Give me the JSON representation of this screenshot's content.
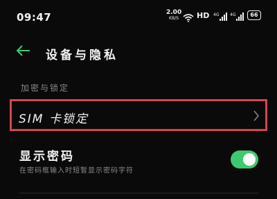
{
  "status_bar": {
    "time": "09:47",
    "net_speed_value": "2.00",
    "net_speed_unit": "KB/S",
    "hd_label": "HD",
    "signal_1_label": "4G",
    "signal_2_label": "4G",
    "battery_level": "66"
  },
  "header": {
    "title": "设备与隐私"
  },
  "section": {
    "label": "加密与锁定"
  },
  "sim_lock": {
    "label": "SIM 卡锁定",
    "highlight_color": "#d8434f"
  },
  "show_password": {
    "title": "显示密码",
    "description": "在密码框输入时短暂显示密码字符",
    "enabled": true,
    "toggle_color": "#3ec96e"
  },
  "icons": {
    "back": "arrow-left-icon",
    "chevron": "chevron-right-icon",
    "wifi": "wifi-icon"
  },
  "colors": {
    "accent": "#3ec96e",
    "highlight": "#d8434f",
    "background": "#0a0a0a"
  }
}
